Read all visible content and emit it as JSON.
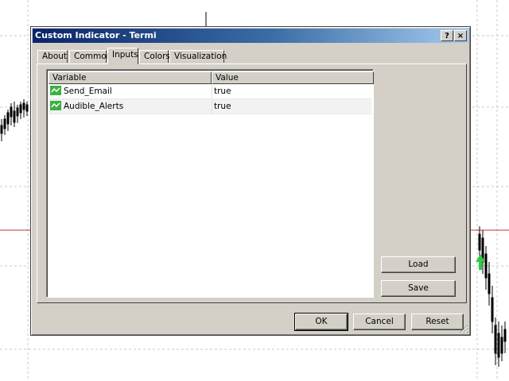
{
  "window": {
    "title": "Custom Indicator - Termi"
  },
  "titlebar_buttons": {
    "help": "?",
    "close": "×"
  },
  "tabs": [
    {
      "label": "About",
      "active": false
    },
    {
      "label": "Common",
      "active": false
    },
    {
      "label": "Inputs",
      "active": true
    },
    {
      "label": "Colors",
      "active": false
    },
    {
      "label": "Visualization",
      "active": false
    }
  ],
  "inputs_table": {
    "columns": [
      "Variable",
      "Value"
    ],
    "rows": [
      {
        "variable": "Send_Email",
        "value": "true",
        "icon": "boolean-param-icon"
      },
      {
        "variable": "Audible_Alerts",
        "value": "true",
        "icon": "boolean-param-icon"
      }
    ]
  },
  "side_buttons": {
    "load": "Load",
    "save": "Save"
  },
  "footer_buttons": {
    "ok": "OK",
    "cancel": "Cancel",
    "reset": "Reset"
  },
  "colors": {
    "titlebar_start": "#0a246a",
    "dialog_bg": "#d4d0c8",
    "price_line": "#c0392b",
    "buy_arrow": "#2ecc40"
  }
}
